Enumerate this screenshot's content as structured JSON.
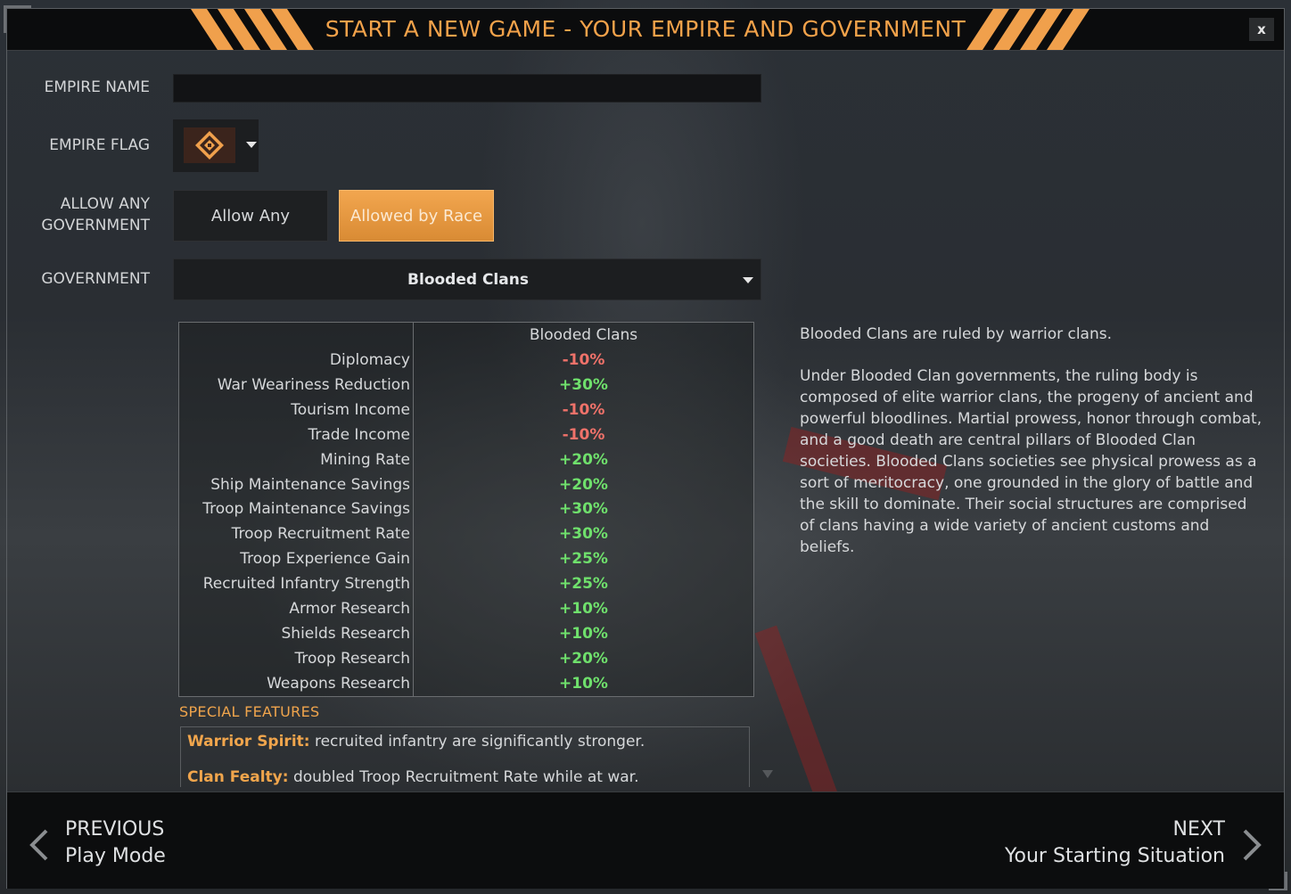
{
  "title": "START A NEW GAME - YOUR EMPIRE AND GOVERNMENT",
  "close_label": "x",
  "form": {
    "empire_name_label": "EMPIRE NAME",
    "empire_name_value": "",
    "empire_flag_label": "EMPIRE FLAG",
    "allow_label_line1": "ALLOW ANY",
    "allow_label_line2": "GOVERNMENT",
    "allow_options": [
      "Allow Any",
      "Allowed by Race"
    ],
    "allow_selected": "Allowed by Race",
    "government_label": "GOVERNMENT",
    "government_value": "Blooded Clans"
  },
  "table": {
    "column_header": "Blooded Clans",
    "rows": [
      {
        "label": "Diplomacy",
        "value": "-10%"
      },
      {
        "label": "War Weariness Reduction",
        "value": "+30%"
      },
      {
        "label": "Tourism Income",
        "value": "-10%"
      },
      {
        "label": "Trade Income",
        "value": "-10%"
      },
      {
        "label": "Mining Rate",
        "value": "+20%"
      },
      {
        "label": "Ship Maintenance Savings",
        "value": "+20%"
      },
      {
        "label": "Troop Maintenance Savings",
        "value": "+30%"
      },
      {
        "label": "Troop Recruitment Rate",
        "value": "+30%"
      },
      {
        "label": "Troop Experience Gain",
        "value": "+25%"
      },
      {
        "label": "Recruited Infantry Strength",
        "value": "+25%"
      },
      {
        "label": "Armor Research",
        "value": "+10%"
      },
      {
        "label": "Shields Research",
        "value": "+10%"
      },
      {
        "label": "Troop Research",
        "value": "+20%"
      },
      {
        "label": "Weapons Research",
        "value": "+10%"
      }
    ]
  },
  "special": {
    "heading": "SPECIAL FEATURES",
    "features": [
      {
        "name": "Warrior Spirit:",
        "text": " recruited infantry are significantly stronger."
      },
      {
        "name": "Clan Fealty:",
        "text": " doubled Troop Recruitment Rate while at war."
      }
    ]
  },
  "description": {
    "p1": "Blooded Clans are ruled by warrior clans.",
    "p2": "Under Blooded Clan governments, the ruling body is composed of elite warrior clans, the progeny of ancient and powerful bloodlines. Martial prowess, honor through combat, and a good death are central pillars of Blooded Clan societies. Blooded Clans societies see physical prowess as a sort of meritocracy, one grounded in the glory of battle and the skill to dominate. Their social structures are comprised of clans having a wide variety of ancient customs and beliefs."
  },
  "footer": {
    "prev_label": "PREVIOUS",
    "prev_sub": "Play Mode",
    "next_label": "NEXT",
    "next_sub": "Your Starting Situation"
  },
  "colors": {
    "accent": "#f3a24a",
    "positive": "#6fe06c",
    "negative": "#f0726a"
  }
}
